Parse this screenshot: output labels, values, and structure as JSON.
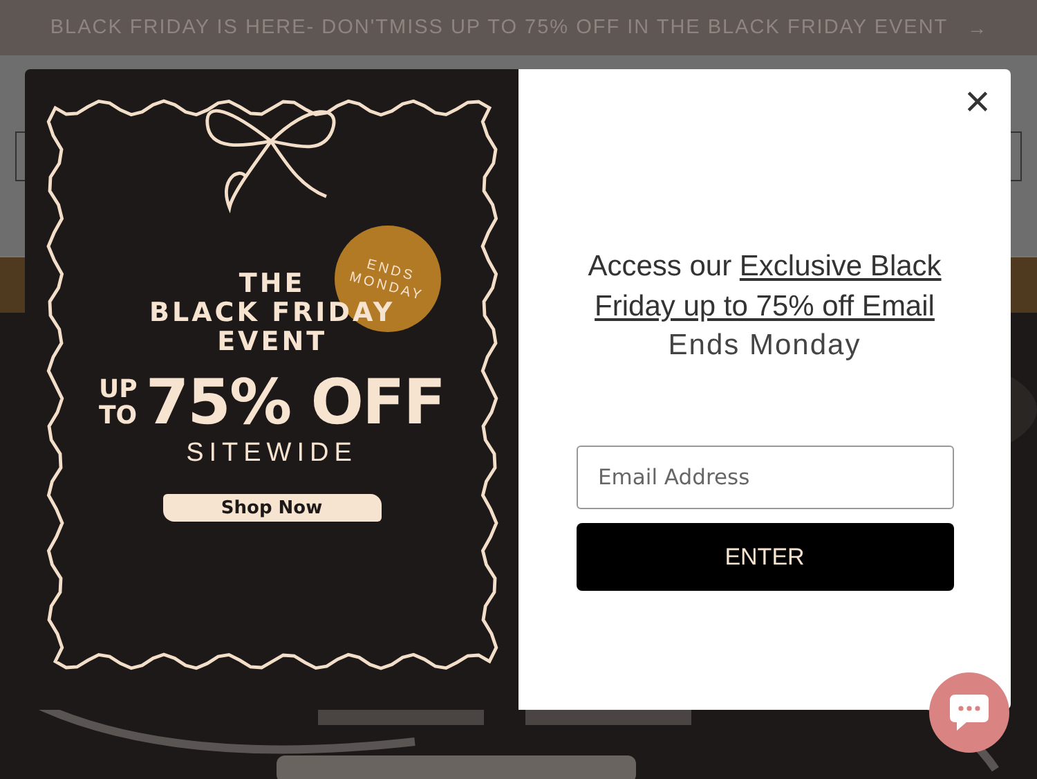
{
  "announcement": {
    "text": "BLACK FRIDAY IS HERE- DON'TMISS UP TO 75% OFF IN THE BLACK FRIDAY EVENT",
    "arrow": "→"
  },
  "popup": {
    "promo": {
      "title_lines": [
        "THE",
        "BLACK FRIDAY",
        "EVENT"
      ],
      "badge": "ENDS MONDAY",
      "up_to": [
        "UP",
        "TO"
      ],
      "discount": "75% OFF",
      "scope": "SITEWIDE",
      "button": "Shop Now"
    },
    "close": "×",
    "heading": {
      "text": "Access our",
      "link": "Exclusive Black Friday up to 75% off Email"
    },
    "subheading": "Ends Monday",
    "email": {
      "placeholder": "Email Address"
    },
    "submit": "ENTER"
  },
  "chat": {
    "kind": "chat"
  }
}
